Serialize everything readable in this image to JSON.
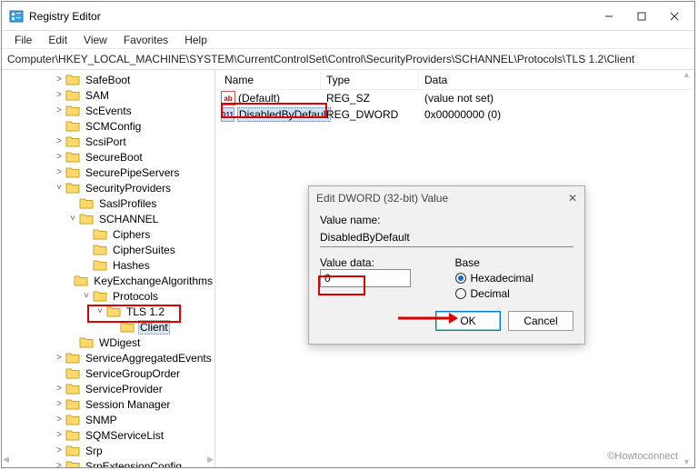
{
  "title": "Registry Editor",
  "menus": [
    "File",
    "Edit",
    "View",
    "Favorites",
    "Help"
  ],
  "address": "Computer\\HKEY_LOCAL_MACHINE\\SYSTEM\\CurrentControlSet\\Control\\SecurityProviders\\SCHANNEL\\Protocols\\TLS 1.2\\Client",
  "tree": [
    {
      "indent": 2,
      "tw": ">",
      "label": "SafeBoot"
    },
    {
      "indent": 2,
      "tw": ">",
      "label": "SAM"
    },
    {
      "indent": 2,
      "tw": ">",
      "label": "ScEvents"
    },
    {
      "indent": 2,
      "tw": "",
      "label": "SCMConfig"
    },
    {
      "indent": 2,
      "tw": ">",
      "label": "ScsiPort"
    },
    {
      "indent": 2,
      "tw": ">",
      "label": "SecureBoot"
    },
    {
      "indent": 2,
      "tw": ">",
      "label": "SecurePipeServers"
    },
    {
      "indent": 2,
      "tw": "v",
      "label": "SecurityProviders"
    },
    {
      "indent": 3,
      "tw": "",
      "label": "SaslProfiles"
    },
    {
      "indent": 3,
      "tw": "v",
      "label": "SCHANNEL"
    },
    {
      "indent": 4,
      "tw": "",
      "label": "Ciphers"
    },
    {
      "indent": 4,
      "tw": "",
      "label": "CipherSuites"
    },
    {
      "indent": 4,
      "tw": "",
      "label": "Hashes"
    },
    {
      "indent": 4,
      "tw": "",
      "label": "KeyExchangeAlgorithms"
    },
    {
      "indent": 4,
      "tw": "v",
      "label": "Protocols"
    },
    {
      "indent": 5,
      "tw": "v",
      "label": "TLS 1.2"
    },
    {
      "indent": 6,
      "tw": "",
      "label": "Client",
      "selected": true
    },
    {
      "indent": 3,
      "tw": "",
      "label": "WDigest"
    },
    {
      "indent": 2,
      "tw": ">",
      "label": "ServiceAggregatedEvents"
    },
    {
      "indent": 2,
      "tw": "",
      "label": "ServiceGroupOrder"
    },
    {
      "indent": 2,
      "tw": ">",
      "label": "ServiceProvider"
    },
    {
      "indent": 2,
      "tw": ">",
      "label": "Session Manager"
    },
    {
      "indent": 2,
      "tw": ">",
      "label": "SNMP"
    },
    {
      "indent": 2,
      "tw": ">",
      "label": "SQMServiceList"
    },
    {
      "indent": 2,
      "tw": ">",
      "label": "Srp"
    },
    {
      "indent": 2,
      "tw": ">",
      "label": "SrpExtensionConfig"
    }
  ],
  "list_head": {
    "name": "Name",
    "type": "Type",
    "data": "Data"
  },
  "values": [
    {
      "icon": "ab",
      "name": "(Default)",
      "type": "REG_SZ",
      "data": "(value not set)"
    },
    {
      "icon": "bin",
      "name": "DisabledByDefault",
      "type": "REG_DWORD",
      "data": "0x00000000 (0)",
      "selected": true
    }
  ],
  "dialog": {
    "title": "Edit DWORD (32-bit) Value",
    "value_name_label": "Value name:",
    "value_name": "DisabledByDefault",
    "value_data_label": "Value data:",
    "value_data": "0",
    "base_label": "Base",
    "hex": "Hexadecimal",
    "dec": "Decimal",
    "ok": "OK",
    "cancel": "Cancel"
  },
  "watermark": "©Howtoconnect"
}
